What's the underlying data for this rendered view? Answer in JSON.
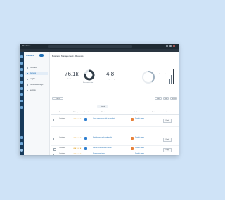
{
  "window": {
    "title": "Reviews"
  },
  "header": {
    "page_title": "Business Management · Reviews"
  },
  "sidebar": {
    "brand": "reviews",
    "items": [
      {
        "label": "Overview",
        "active": false
      },
      {
        "label": "Reviews",
        "active": true
      },
      {
        "label": "Insights",
        "active": false
      },
      {
        "label": "Customer settings",
        "active": false
      },
      {
        "label": "Settings",
        "active": false
      }
    ]
  },
  "kpis": {
    "total_reviews": "76.1k",
    "total_reviews_label": "Total reviews",
    "response_label": "Response rate",
    "avg_rating": "4.8",
    "avg_rating_label": "Average rating",
    "sentiment_label": "Sentiment"
  },
  "toolbar": {
    "left_button": "Filters",
    "center_tab": "Export",
    "right_buttons": [
      "Sort",
      "Date",
      "Share"
    ]
  },
  "table": {
    "headers": [
      "",
      "Name",
      "Rating",
      "Location",
      "Review",
      "Product",
      "Date",
      "Action"
    ],
    "rows": [
      {
        "name": "Customer",
        "review": "Great experience with the product",
        "product": "Product name",
        "action": "Reply"
      },
      {
        "name": "Customer",
        "review": "Fast delivery and good quality",
        "product": "Product name",
        "action": "Reply"
      },
      {
        "name": "Customer",
        "review": "Would recommend to friends",
        "product": "Product name",
        "action": "Reply"
      },
      {
        "name": "Customer",
        "review": "Nice support team",
        "product": "Product name",
        "action": "Reply"
      }
    ]
  },
  "colors": {
    "accent": "#1f6fb5",
    "rail": "#173a5a",
    "star": "#e4a52a"
  }
}
